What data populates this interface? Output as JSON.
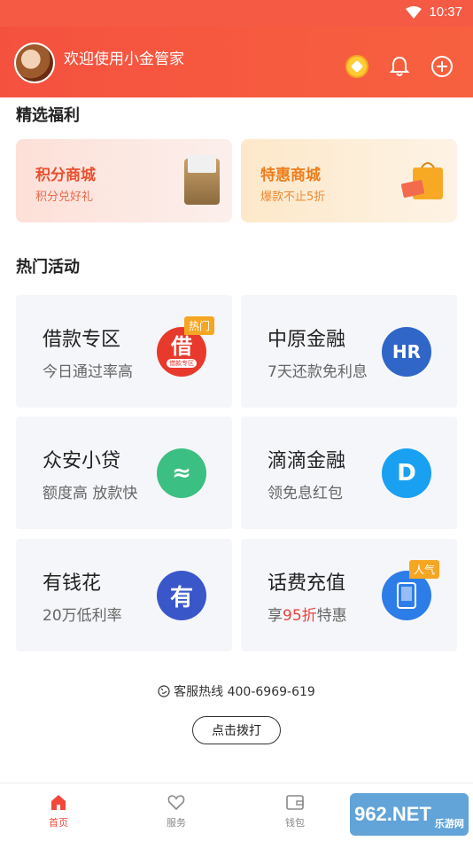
{
  "status": {
    "time": "10:37"
  },
  "header": {
    "welcome": "欢迎使用小金管家"
  },
  "welfare": {
    "title": "精选福利",
    "cards": [
      {
        "title": "积分商城",
        "subtitle": "积分兑好礼"
      },
      {
        "title": "特惠商城",
        "subtitle": "爆款不止5折"
      }
    ]
  },
  "activities": {
    "title": "热门活动",
    "items": [
      {
        "title": "借款专区",
        "subtitle": "今日通过率高",
        "icon_text": "借",
        "icon_sub": "借款专区",
        "tag": "热门",
        "icon_color": "#e8392d"
      },
      {
        "title": "中原金融",
        "subtitle": "7天还款免利息",
        "icon_text": "HR",
        "icon_color": "#2f66c8"
      },
      {
        "title": "众安小贷",
        "subtitle": "额度高 放款快",
        "icon_text": "≈",
        "icon_color": "#3cbf82"
      },
      {
        "title": "滴滴金融",
        "subtitle": "领免息红包",
        "icon_text": "D",
        "icon_color": "#1aa0f0"
      },
      {
        "title": "有钱花",
        "subtitle": "20万低利率",
        "icon_text": "有",
        "icon_color": "#3a57c9"
      },
      {
        "title": "话费充值",
        "subtitle_pre": "享",
        "subtitle_hl": "95折",
        "subtitle_post": "特惠",
        "tag": "人气",
        "icon_color": "#2d7de8"
      }
    ]
  },
  "footer": {
    "hotline": "客服热线 400-6969-619",
    "call_button": "点击拨打"
  },
  "tabbar": {
    "items": [
      "首页",
      "服务",
      "钱包"
    ]
  },
  "watermark": {
    "text": "962.NET",
    "sub": "乐游网"
  }
}
